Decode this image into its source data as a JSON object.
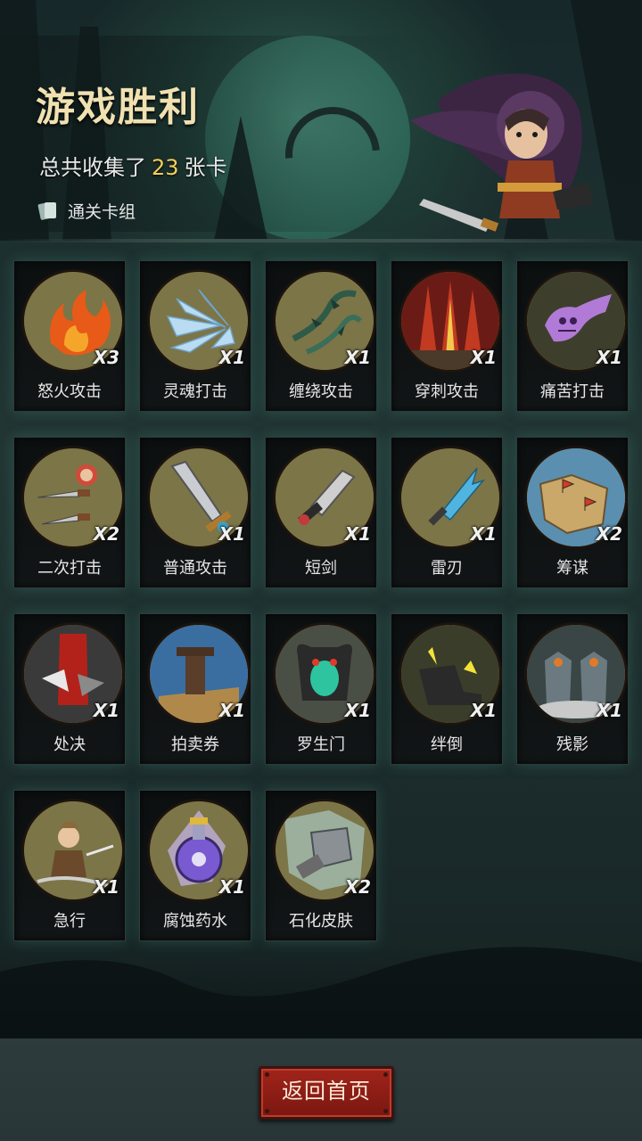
{
  "header": {
    "title": "游戏胜利",
    "collected_prefix": "总共收集了",
    "collected_count": "23",
    "collected_suffix": "张卡",
    "deck_label": "通关卡组"
  },
  "cards": [
    {
      "name": "怒火攻击",
      "count": "X3",
      "icon": "flame-icon"
    },
    {
      "name": "灵魂打击",
      "count": "X1",
      "icon": "ice-burst-icon"
    },
    {
      "name": "缠绕攻击",
      "count": "X1",
      "icon": "thorn-vine-icon"
    },
    {
      "name": "穿刺攻击",
      "count": "X1",
      "icon": "spikes-icon"
    },
    {
      "name": "痛苦打击",
      "count": "X1",
      "icon": "ghost-hand-icon"
    },
    {
      "name": "二次打击",
      "count": "X2",
      "icon": "double-dagger-icon"
    },
    {
      "name": "普通攻击",
      "count": "X1",
      "icon": "broadsword-icon"
    },
    {
      "name": "短剑",
      "count": "X1",
      "icon": "short-sword-icon"
    },
    {
      "name": "雷刃",
      "count": "X1",
      "icon": "lightning-dagger-icon"
    },
    {
      "name": "筹谋",
      "count": "X2",
      "icon": "map-icon"
    },
    {
      "name": "处决",
      "count": "X1",
      "icon": "execution-icon"
    },
    {
      "name": "拍卖券",
      "count": "X1",
      "icon": "gavel-icon"
    },
    {
      "name": "罗生门",
      "count": "X1",
      "icon": "demon-gate-icon"
    },
    {
      "name": "绊倒",
      "count": "X1",
      "icon": "trip-boot-icon"
    },
    {
      "name": "残影",
      "count": "X1",
      "icon": "shadow-clones-icon"
    },
    {
      "name": "急行",
      "count": "X1",
      "icon": "dash-warrior-icon"
    },
    {
      "name": "腐蚀药水",
      "count": "X1",
      "icon": "potion-icon"
    },
    {
      "name": "石化皮肤",
      "count": "X2",
      "icon": "stone-skin-icon"
    }
  ],
  "footer": {
    "home_label": "返回首页"
  },
  "colors": {
    "title": "#f1e1b1",
    "count_highlight": "#f3cf5a",
    "button": "#a0241b",
    "card_glow": "#46a08c"
  }
}
